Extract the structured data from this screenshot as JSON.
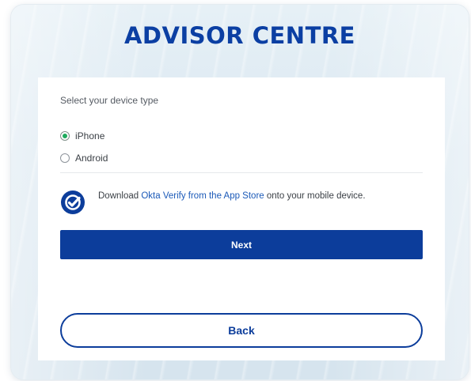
{
  "brand": {
    "title": "ADVISOR CENTRE"
  },
  "device_select": {
    "prompt": "Select your device type",
    "options": [
      {
        "label": "iPhone",
        "selected": true
      },
      {
        "label": "Android",
        "selected": false
      }
    ]
  },
  "info": {
    "prefix": "Download ",
    "link": "Okta Verify from the App Store",
    "suffix": " onto your mobile device.",
    "icon": "check-badge-icon"
  },
  "buttons": {
    "next": "Next",
    "back": "Back"
  },
  "colors": {
    "primary": "#0c3d9b",
    "link": "#1a59b8",
    "radio_selected": "#1eaa5c",
    "brand_text": "#0b3fa3"
  }
}
